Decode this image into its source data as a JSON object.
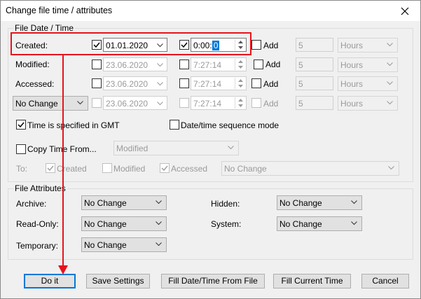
{
  "window": {
    "title": "Change file time / attributes"
  },
  "date_time": {
    "group_label": "File Date / Time",
    "rows": [
      {
        "label": "Created:",
        "date": "01.01.2020",
        "time_prefix": "0:00:",
        "time_selected": "0",
        "add_label": "Add",
        "add_value": "5",
        "unit": "Hours"
      },
      {
        "label": "Modified:",
        "date": "23.06.2020",
        "time": "7:27:14",
        "add_label": "Add",
        "add_value": "5",
        "unit": "Hours"
      },
      {
        "label": "Accessed:",
        "date": "23.06.2020",
        "time": "7:27:14",
        "add_label": "Add",
        "add_value": "5",
        "unit": "Hours"
      },
      {
        "select": "No Change",
        "date": "23.06.2020",
        "time": "7:27:14",
        "add_label": "Add",
        "add_value": "5",
        "unit": "Hours"
      }
    ],
    "gmt_label": "Time is specified in GMT",
    "sequence_label": "Date/time sequence mode",
    "copy_label": "Copy Time From...",
    "copy_source": "Modified",
    "to_label": "To:",
    "to_created": "Created",
    "to_modified": "Modified",
    "to_accessed": "Accessed",
    "to_select": "No Change"
  },
  "attributes": {
    "group_label": "File Attributes",
    "archive_label": "Archive:",
    "archive_value": "No Change",
    "hidden_label": "Hidden:",
    "hidden_value": "No Change",
    "readonly_label": "Read-Only:",
    "readonly_value": "No Change",
    "system_label": "System:",
    "system_value": "No Change",
    "temporary_label": "Temporary:",
    "temporary_value": "No Change"
  },
  "buttons": {
    "do_it": "Do it",
    "save_settings": "Save Settings",
    "fill_from_file": "Fill Date/Time From File",
    "fill_current": "Fill Current Time",
    "cancel": "Cancel"
  },
  "annotation_color": "#e8131c"
}
